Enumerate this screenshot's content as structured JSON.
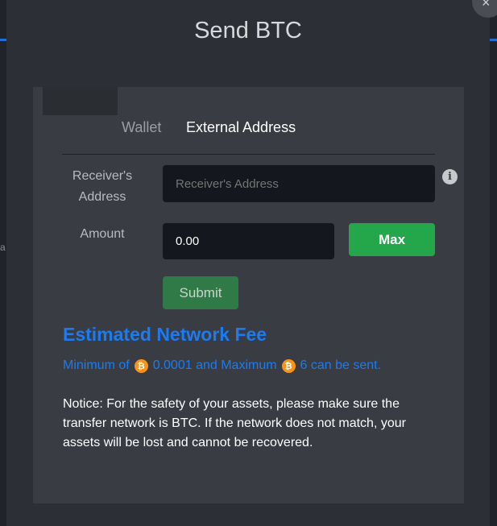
{
  "background": {
    "edge_char": "a"
  },
  "modal": {
    "title": "Send BTC",
    "close_symbol": "×"
  },
  "tabs": [
    {
      "label": "Wallet",
      "active": false
    },
    {
      "label": "External Address",
      "active": true
    }
  ],
  "form": {
    "receiver_label_line1": "Receiver's",
    "receiver_label_line2": "Address",
    "receiver_placeholder": "Receiver's Address",
    "receiver_value": "",
    "amount_label": "Amount",
    "amount_value": "0.00",
    "max_label": "Max",
    "submit_label": "Submit",
    "info_symbol": "i"
  },
  "fee": {
    "title": "Estimated Network Fee",
    "line_part1": "Minimum of",
    "min_value": "0.0001 and Maximum",
    "max_value": "6 can be sent."
  },
  "notice": "Notice: For the safety of your assets, please make sure the transfer network is BTC. If the network does not match, your assets will be lost and cannot be recovered.",
  "colors": {
    "accent_blue": "#1b7cf2",
    "max_green": "#23a74a",
    "submit_green": "#2f7a46",
    "btc_orange": "#f7931a"
  }
}
